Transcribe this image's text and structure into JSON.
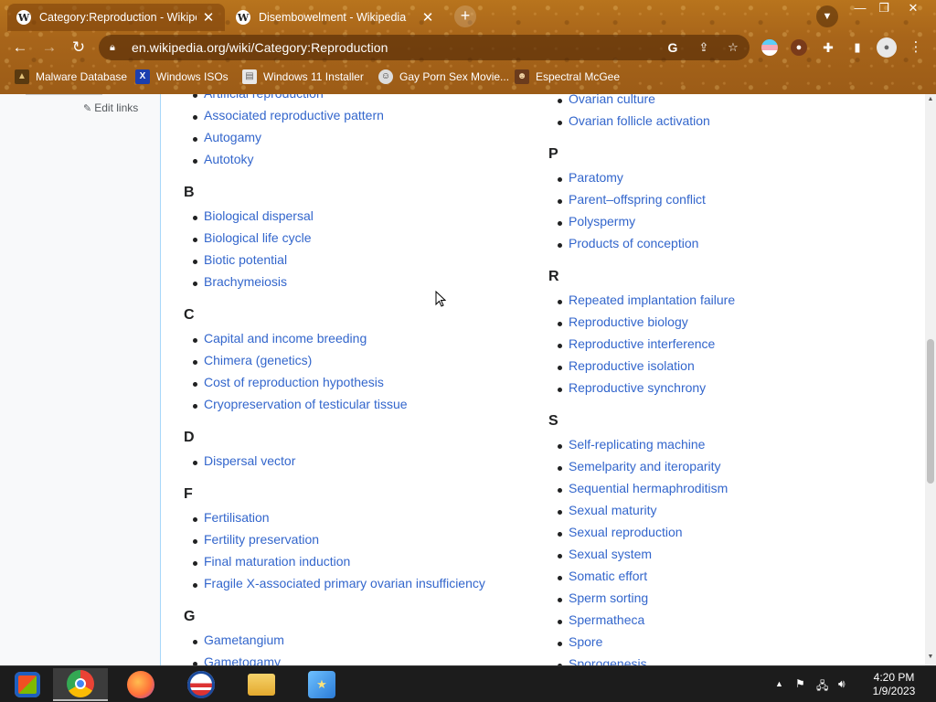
{
  "browser": {
    "tabs": [
      {
        "title": "Category:Reproduction - Wikipedia",
        "favicon": "W",
        "active": true
      },
      {
        "title": "Disembowelment - Wikipedia",
        "favicon": "W",
        "active": false
      }
    ],
    "new_tab": "+",
    "url": "en.wikipedia.org/wiki/Category:Reproduction",
    "bookmarks": [
      {
        "label": "Malware Database",
        "icon": "malware-icon"
      },
      {
        "label": "Windows ISOs",
        "icon": "x-icon"
      },
      {
        "label": "Windows 11 Installer",
        "icon": "page-icon"
      },
      {
        "label": "Gay Porn Sex Movie...",
        "icon": "site-icon"
      },
      {
        "label": "Espectral McGee",
        "icon": "avatar-icon"
      }
    ],
    "accent_color": "#a8651a"
  },
  "page": {
    "edit_links": "Edit links",
    "left_column": [
      {
        "type": "item",
        "text": "Artificial reproduction"
      },
      {
        "type": "item",
        "text": "Associated reproductive pattern"
      },
      {
        "type": "item",
        "text": "Autogamy"
      },
      {
        "type": "item",
        "text": "Autotoky"
      },
      {
        "type": "letter",
        "text": "B"
      },
      {
        "type": "item",
        "text": "Biological dispersal"
      },
      {
        "type": "item",
        "text": "Biological life cycle"
      },
      {
        "type": "item",
        "text": "Biotic potential"
      },
      {
        "type": "item",
        "text": "Brachymeiosis"
      },
      {
        "type": "letter",
        "text": "C"
      },
      {
        "type": "item",
        "text": "Capital and income breeding"
      },
      {
        "type": "item",
        "text": "Chimera (genetics)"
      },
      {
        "type": "item",
        "text": "Cost of reproduction hypothesis"
      },
      {
        "type": "item",
        "text": "Cryopreservation of testicular tissue"
      },
      {
        "type": "letter",
        "text": "D"
      },
      {
        "type": "item",
        "text": "Dispersal vector"
      },
      {
        "type": "letter",
        "text": "F"
      },
      {
        "type": "item",
        "text": "Fertilisation"
      },
      {
        "type": "item",
        "text": "Fertility preservation"
      },
      {
        "type": "item",
        "text": "Final maturation induction"
      },
      {
        "type": "item",
        "text": "Fragile X-associated primary ovarian insufficiency"
      },
      {
        "type": "letter",
        "text": "G"
      },
      {
        "type": "item",
        "text": "Gametangium"
      },
      {
        "type": "item",
        "text": "Gametogamy"
      }
    ],
    "right_column": [
      {
        "type": "item",
        "text": "Ovarian culture"
      },
      {
        "type": "item",
        "text": "Ovarian follicle activation"
      },
      {
        "type": "letter",
        "text": "P"
      },
      {
        "type": "item",
        "text": "Paratomy"
      },
      {
        "type": "item",
        "text": "Parent–offspring conflict"
      },
      {
        "type": "item",
        "text": "Polyspermy"
      },
      {
        "type": "item",
        "text": "Products of conception"
      },
      {
        "type": "letter",
        "text": "R"
      },
      {
        "type": "item",
        "text": "Repeated implantation failure"
      },
      {
        "type": "item",
        "text": "Reproductive biology"
      },
      {
        "type": "item",
        "text": "Reproductive interference"
      },
      {
        "type": "item",
        "text": "Reproductive isolation"
      },
      {
        "type": "item",
        "text": "Reproductive synchrony"
      },
      {
        "type": "letter",
        "text": "S"
      },
      {
        "type": "item",
        "text": "Self-replicating machine"
      },
      {
        "type": "item",
        "text": "Semelparity and iteroparity"
      },
      {
        "type": "item",
        "text": "Sequential hermaphroditism"
      },
      {
        "type": "item",
        "text": "Sexual maturity"
      },
      {
        "type": "item",
        "text": "Sexual reproduction"
      },
      {
        "type": "item",
        "text": "Sexual system"
      },
      {
        "type": "item",
        "text": "Somatic effort"
      },
      {
        "type": "item",
        "text": "Sperm sorting"
      },
      {
        "type": "item",
        "text": "Spermatheca"
      },
      {
        "type": "item",
        "text": "Spore"
      },
      {
        "type": "item",
        "text": "Sporogenesis"
      }
    ],
    "link_color": "#3366cc"
  },
  "taskbar": {
    "apps": [
      {
        "name": "start-icon"
      },
      {
        "name": "chrome-icon",
        "active": true
      },
      {
        "name": "firefox-icon"
      },
      {
        "name": "obama-logo-icon"
      },
      {
        "name": "file-explorer-icon"
      },
      {
        "name": "network-app-icon"
      }
    ],
    "time": "4:20 PM",
    "date": "1/9/2023"
  }
}
